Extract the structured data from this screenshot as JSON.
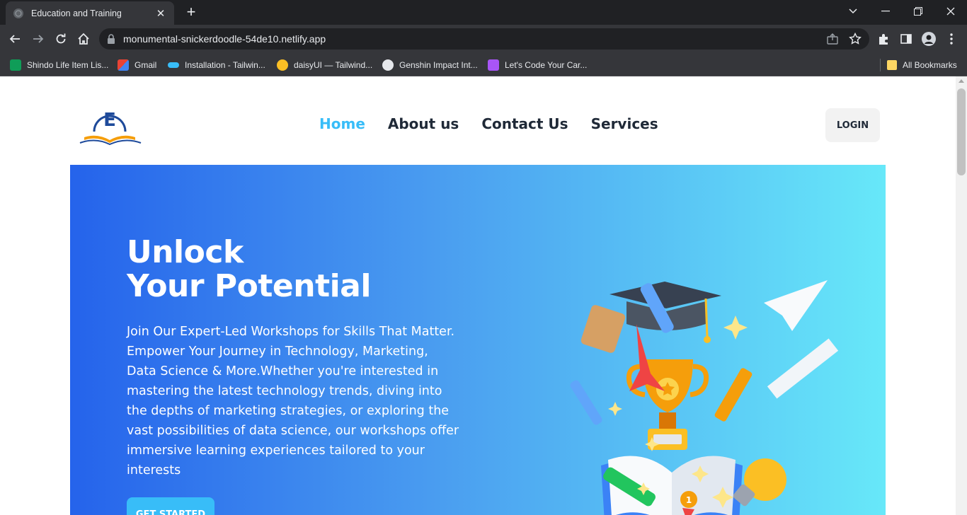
{
  "browser": {
    "tab_title": "Education and Training",
    "url": "monumental-snickerdoodle-54de10.netlify.app",
    "bookmarks": [
      {
        "label": "Shindo Life Item Lis...",
        "icon": "sheets-icon",
        "color": "#0f9d58"
      },
      {
        "label": "Gmail",
        "icon": "gmail-icon",
        "color": "#ea4335"
      },
      {
        "label": "Installation - Tailwin...",
        "icon": "tailwind-icon",
        "color": "#38bdf8"
      },
      {
        "label": "daisyUI — Tailwind...",
        "icon": "daisyui-icon",
        "color": "#fbbf24"
      },
      {
        "label": "Genshin Impact Int...",
        "icon": "genshin-icon",
        "color": "#e5e7eb"
      },
      {
        "label": "Let's Code Your Car...",
        "icon": "letscode-icon",
        "color": "#a855f7"
      }
    ],
    "all_bookmarks": "All Bookmarks"
  },
  "site": {
    "logo_letter": "E",
    "nav": [
      {
        "label": "Home",
        "active": true
      },
      {
        "label": "About us",
        "active": false
      },
      {
        "label": "Contact Us",
        "active": false
      },
      {
        "label": "Services",
        "active": false
      }
    ],
    "login_label": "LOGIN"
  },
  "hero": {
    "title_line1": "Unlock",
    "title_line2": "Your Potential",
    "body": "Join Our Expert-Led Workshops for Skills That Matter. Empower Your Journey in Technology, Marketing, Data Science & More.Whether you're interested in mastering the latest technology trends, diving into the depths of marketing strategies, or exploring the vast possibilities of data science, our workshops offer immersive learning experiences tailored to your interests",
    "cta_label": "GET STARTED",
    "medal_number": "1"
  },
  "colors": {
    "accent": "#38bdf8",
    "hero_gradient_start": "#2563eb",
    "hero_gradient_end": "#67e8f9"
  }
}
